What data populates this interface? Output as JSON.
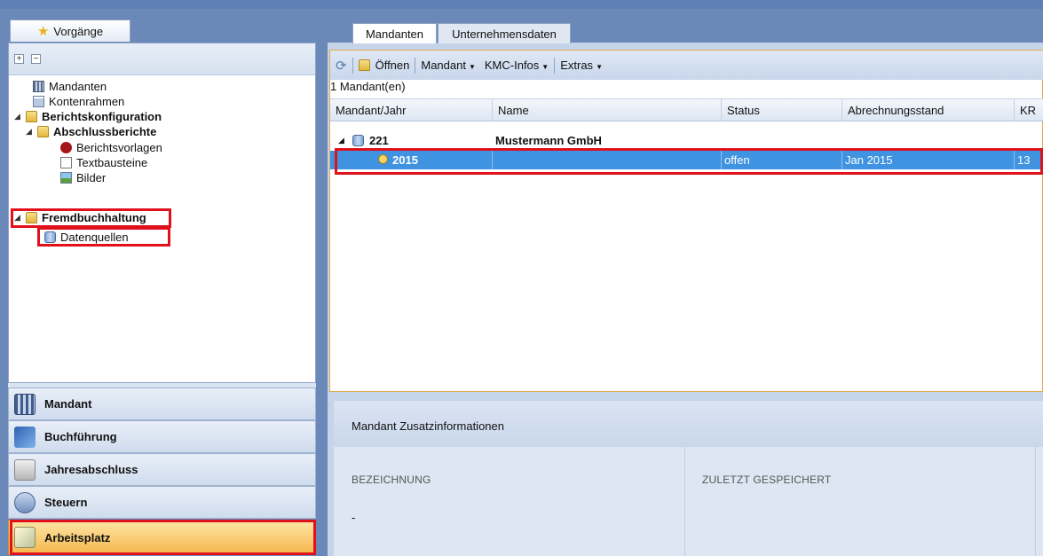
{
  "left_panel": {
    "tab_label": "Vorgänge",
    "expand_label": "+",
    "collapse_label": "−",
    "tree": [
      {
        "label": "Mandanten",
        "icon": "grid-icon"
      },
      {
        "label": "Kontenrahmen",
        "icon": "document-icon"
      },
      {
        "label": "Berichtskonfiguration",
        "icon": "folder-icon",
        "bold": true,
        "expanded": true
      },
      {
        "label": "Abschlussberichte",
        "icon": "folder-icon",
        "bold": true,
        "expanded": true
      },
      {
        "label": "Berichtsvorlagen",
        "icon": "book-icon"
      },
      {
        "label": "Textbausteine",
        "icon": "page-icon"
      },
      {
        "label": "Bilder",
        "icon": "image-icon"
      },
      {
        "label": "Fremdbuchhaltung",
        "icon": "folder-icon",
        "bold": true,
        "expanded": true
      },
      {
        "label": "Datenquellen",
        "icon": "database-icon"
      }
    ],
    "splitter_grip": "..........",
    "nav_buttons": [
      {
        "label": "Mandant",
        "icon": "grid-icon"
      },
      {
        "label": "Buchführung",
        "icon": "book-icon"
      },
      {
        "label": "Jahresabschluss",
        "icon": "scales-icon"
      },
      {
        "label": "Steuern",
        "icon": "paragraph-icon"
      },
      {
        "label": "Arbeitsplatz",
        "icon": "brush-icon",
        "active": true
      }
    ]
  },
  "right_panel": {
    "tabs": [
      "Mandanten",
      "Unternehmensdaten"
    ],
    "active_tab": "Mandanten",
    "toolbar": {
      "refresh_icon": "refresh-icon",
      "open_label": "Öffnen",
      "mandant_label": "Mandant",
      "kmc_label": "KMC-Infos",
      "extras_label": "Extras",
      "dropdown_caret": "▼"
    },
    "count_text": "1 Mandant(en)",
    "columns": [
      "Mandant/Jahr",
      "Name",
      "Status",
      "Abrechnungsstand",
      "KR"
    ],
    "rows": [
      {
        "expand": "◢",
        "id": "221",
        "name": "Mustermann GmbH",
        "status": "",
        "stand": "",
        "kr": "",
        "icon": "database-icon"
      },
      {
        "expand": "",
        "id": "2015",
        "name": "",
        "status": "offen",
        "stand": "Jan 2015",
        "kr": "13",
        "icon": "clock-icon",
        "selected": true
      }
    ],
    "info": {
      "title": "Mandant Zusatzinformationen",
      "bezeichnung_label": "BEZEICHNUNG",
      "bezeichnung_value": "-",
      "zuletzt_label": "ZULETZT GESPEICHERT"
    }
  },
  "colors": {
    "highlight": "#e0111b",
    "selection": "#3f93e0",
    "active_nav": "#f6b64c"
  }
}
